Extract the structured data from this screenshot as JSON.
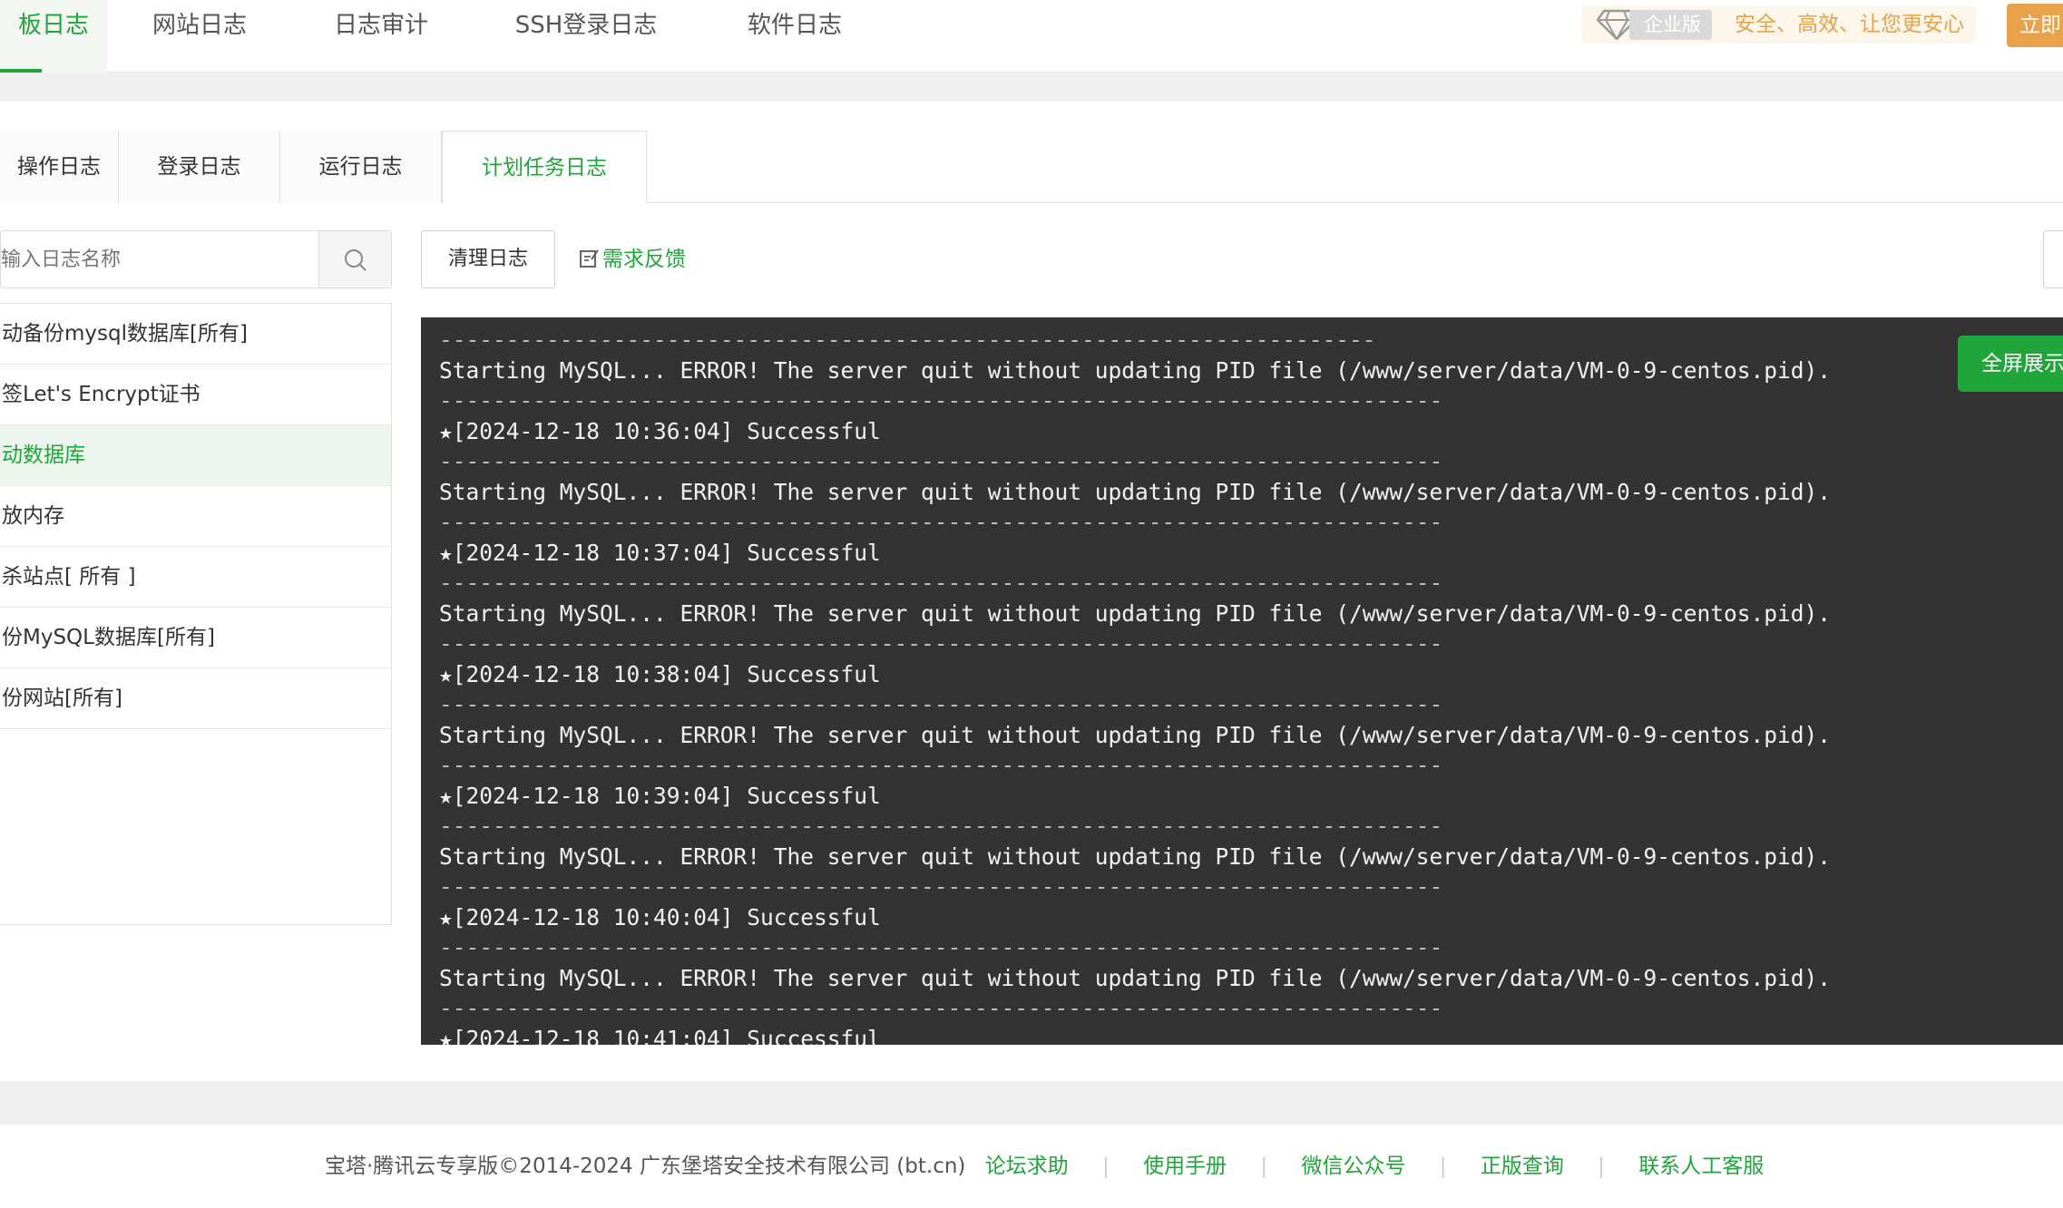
{
  "top_tabs": [
    "板日志",
    "网站日志",
    "日志审计",
    "SSH登录日志",
    "软件日志"
  ],
  "promo": {
    "badge": "企业版",
    "slogan": "安全、高效、让您更安心",
    "buy_label": "立即"
  },
  "sub_tabs": [
    "操作日志",
    "登录日志",
    "运行日志",
    "计划任务日志"
  ],
  "search": {
    "placeholder": "输入日志名称"
  },
  "task_list": [
    "动备份mysql数据库[所有]",
    "签Let's Encrypt证书",
    "动数据库",
    "放内存",
    "杀站点[ 所有 ]",
    "份MySQL数据库[所有]",
    "份网站[所有]"
  ],
  "toolbar": {
    "clear_label": "清理日志",
    "feedback_label": "需求反馈"
  },
  "console": {
    "fullscreen_label": "全屏展示",
    "lines": [
      "----------------------------------------------------------------------",
      "Starting MySQL... ERROR! The server quit without updating PID file (/www/server/data/VM-0-9-centos.pid).",
      "---------------------------------------------------------------------------",
      "★[2024-12-18 10:36:04] Successful",
      "---------------------------------------------------------------------------",
      "Starting MySQL... ERROR! The server quit without updating PID file (/www/server/data/VM-0-9-centos.pid).",
      "---------------------------------------------------------------------------",
      "★[2024-12-18 10:37:04] Successful",
      "---------------------------------------------------------------------------",
      "Starting MySQL... ERROR! The server quit without updating PID file (/www/server/data/VM-0-9-centos.pid).",
      "---------------------------------------------------------------------------",
      "★[2024-12-18 10:38:04] Successful",
      "---------------------------------------------------------------------------",
      "Starting MySQL... ERROR! The server quit without updating PID file (/www/server/data/VM-0-9-centos.pid).",
      "---------------------------------------------------------------------------",
      "★[2024-12-18 10:39:04] Successful",
      "---------------------------------------------------------------------------",
      "Starting MySQL... ERROR! The server quit without updating PID file (/www/server/data/VM-0-9-centos.pid).",
      "---------------------------------------------------------------------------",
      "★[2024-12-18 10:40:04] Successful",
      "---------------------------------------------------------------------------",
      "Starting MySQL... ERROR! The server quit without updating PID file (/www/server/data/VM-0-9-centos.pid).",
      "---------------------------------------------------------------------------",
      "★[2024-12-18 10:41:04] Successful"
    ]
  },
  "footer": {
    "copyright": "宝塔·腾讯云专享版©2014-2024 广东堡塔安全技术有限公司 (bt.cn)",
    "links": [
      "论坛求助",
      "使用手册",
      "微信公众号",
      "正版查询",
      "联系人工客服"
    ]
  },
  "colors": {
    "accent": "#20a53a",
    "promo": "#e7a24a",
    "console_bg": "#333333"
  }
}
